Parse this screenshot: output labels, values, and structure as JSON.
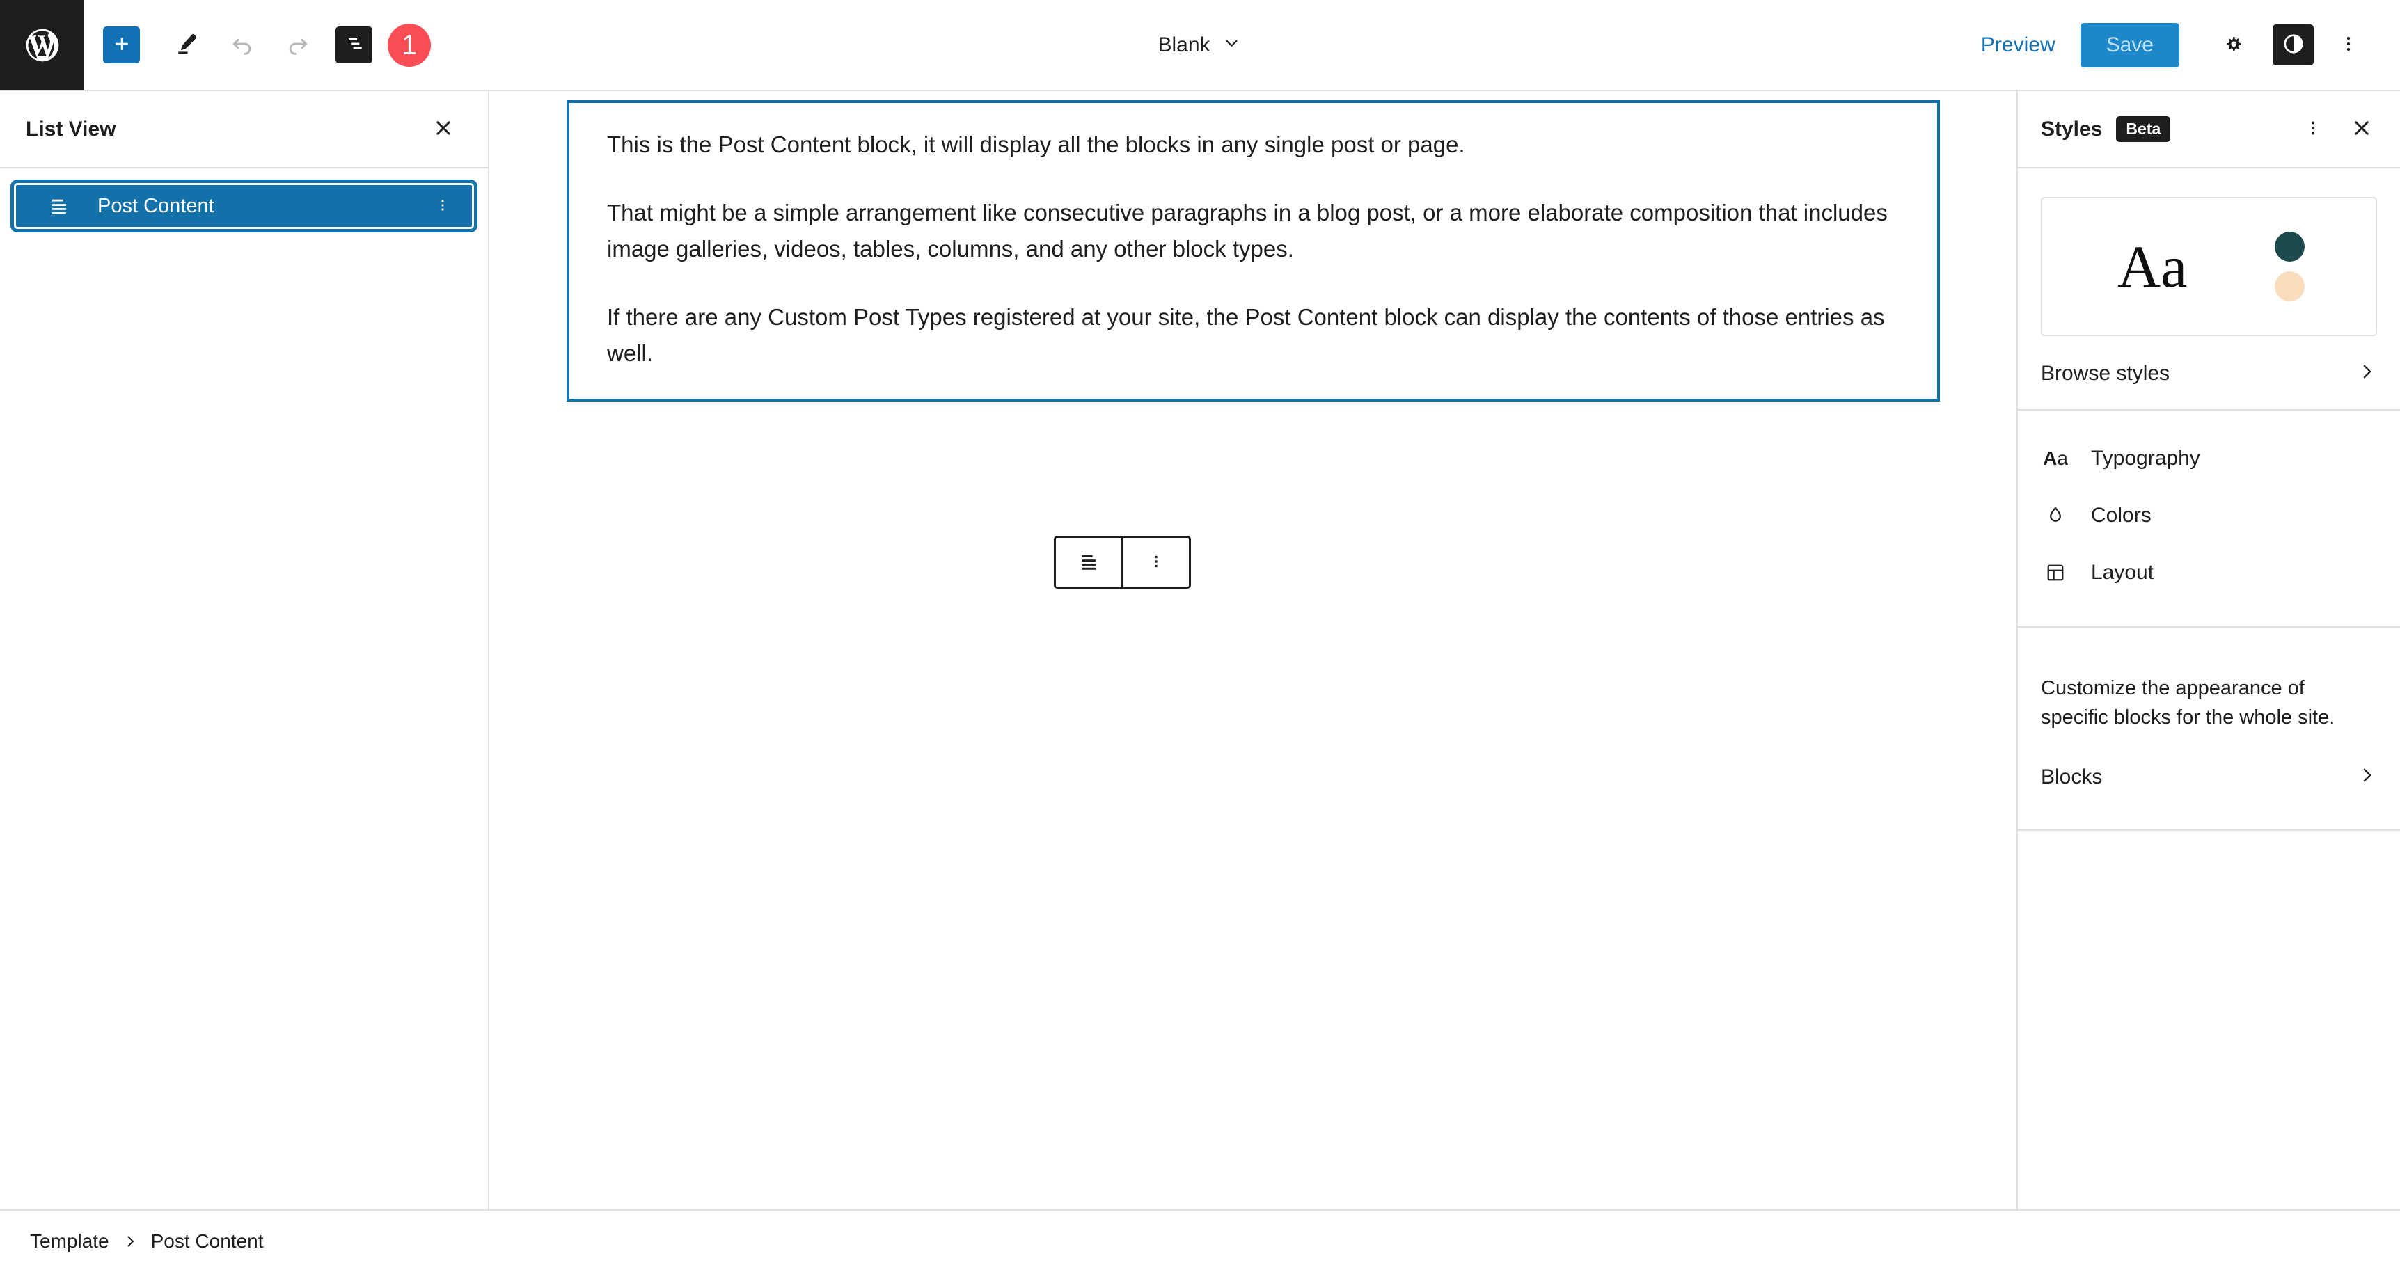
{
  "header": {
    "logo_label": "WordPress",
    "add_block_label": "+",
    "tools": [
      {
        "name": "add-block",
        "label": "Add block"
      },
      {
        "name": "edit-tool",
        "label": "Tools"
      },
      {
        "name": "undo",
        "label": "Undo"
      },
      {
        "name": "redo",
        "label": "Redo"
      },
      {
        "name": "list-view",
        "label": "List View"
      }
    ],
    "marker_number": "1",
    "document_title": "Blank",
    "preview_label": "Preview",
    "save_label": "Save",
    "settings_label": "Settings",
    "styles_label": "Styles",
    "options_label": "Options"
  },
  "list_view": {
    "title": "List View",
    "close_label": "Close",
    "items": [
      {
        "label": "Post Content",
        "icon": "post-content-icon",
        "selected": true
      }
    ]
  },
  "canvas": {
    "block_name": "Post Content",
    "paragraphs": [
      "This is the Post Content block, it will display all the blocks in any single post or page.",
      "That might be a simple arrangement like consecutive paragraphs in a blog post, or a more elaborate composition that includes image galleries, videos, tables, columns, and any other block types.",
      "If there are any Custom Post Types registered at your site, the Post Content block can display the contents of those entries as well."
    ],
    "toolbar": {
      "block_icon_label": "Post Content",
      "options_label": "Options"
    }
  },
  "styles": {
    "title": "Styles",
    "badge": "Beta",
    "more_label": "More",
    "close_label": "Close",
    "preview": {
      "sample_text": "Aa",
      "swatches": [
        "#1d4a4d",
        "#fbddbd"
      ]
    },
    "browse_styles_label": "Browse styles",
    "menu": [
      {
        "label": "Typography",
        "icon": "typography-icon"
      },
      {
        "label": "Colors",
        "icon": "droplet-icon"
      },
      {
        "label": "Layout",
        "icon": "layout-icon"
      }
    ],
    "blocks_description": "Customize the appearance of specific blocks for the whole site.",
    "blocks_label": "Blocks"
  },
  "footer": {
    "breadcrumbs": [
      "Template",
      "Post Content"
    ]
  },
  "colors": {
    "accent_blue": "#1271b5",
    "selection_blue": "#1271a9",
    "marker_red": "#f94c54",
    "dark": "#1e1e1e",
    "border": "#e0e0e0"
  }
}
